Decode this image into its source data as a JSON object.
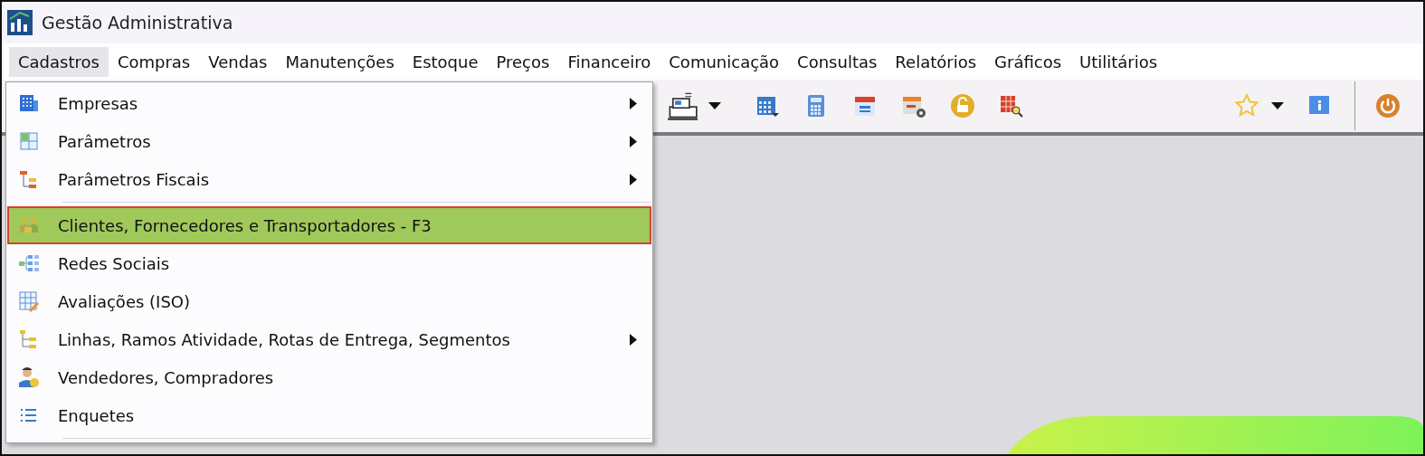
{
  "window": {
    "title": "Gestão Administrativa"
  },
  "menu_bar": [
    {
      "label": "Cadastros",
      "selected": true
    },
    {
      "label": "Compras",
      "selected": false
    },
    {
      "label": "Vendas",
      "selected": false
    },
    {
      "label": "Manutenções",
      "selected": false
    },
    {
      "label": "Estoque",
      "selected": false
    },
    {
      "label": "Preços",
      "selected": false
    },
    {
      "label": "Financeiro",
      "selected": false
    },
    {
      "label": "Comunicação",
      "selected": false
    },
    {
      "label": "Consultas",
      "selected": false
    },
    {
      "label": "Relatórios",
      "selected": false
    },
    {
      "label": "Gráficos",
      "selected": false
    },
    {
      "label": "Utilitários",
      "selected": false
    }
  ],
  "dropdown": [
    {
      "kind": "building",
      "label": "Empresas",
      "submenu": true,
      "selected": false
    },
    {
      "kind": "grid",
      "label": "Parâmetros",
      "submenu": true,
      "selected": false
    },
    {
      "kind": "steps",
      "label": "Parâmetros Fiscais",
      "submenu": true,
      "selected": false
    },
    {
      "kind": "separator"
    },
    {
      "kind": "people",
      "label": "Clientes, Fornecedores e Transportadores - F3",
      "submenu": false,
      "selected": true
    },
    {
      "kind": "network",
      "label": "Redes Sociais",
      "submenu": false,
      "selected": false
    },
    {
      "kind": "sheet",
      "label": "Avaliações (ISO)",
      "submenu": false,
      "selected": false
    },
    {
      "kind": "tree",
      "label": "Linhas, Ramos Atividade, Rotas de Entrega, Segmentos",
      "submenu": true,
      "selected": false
    },
    {
      "kind": "person",
      "label": "Vendedores, Compradores",
      "submenu": false,
      "selected": false
    },
    {
      "kind": "list",
      "label": "Enquetes",
      "submenu": false,
      "selected": false
    },
    {
      "kind": "separator"
    }
  ],
  "toolbar": [
    {
      "kind": "register",
      "dropdown": true
    },
    {
      "kind": "gap"
    },
    {
      "kind": "calendar-grid",
      "dropdown": false
    },
    {
      "kind": "calculator",
      "dropdown": false
    },
    {
      "kind": "calendar",
      "dropdown": false
    },
    {
      "kind": "calendar-gear",
      "dropdown": false
    },
    {
      "kind": "lock",
      "dropdown": false
    },
    {
      "kind": "search-grid",
      "dropdown": false
    },
    {
      "kind": "spacer"
    },
    {
      "kind": "star",
      "dropdown": true
    },
    {
      "kind": "info",
      "dropdown": false
    },
    {
      "kind": "divider"
    },
    {
      "kind": "power",
      "dropdown": false
    }
  ]
}
